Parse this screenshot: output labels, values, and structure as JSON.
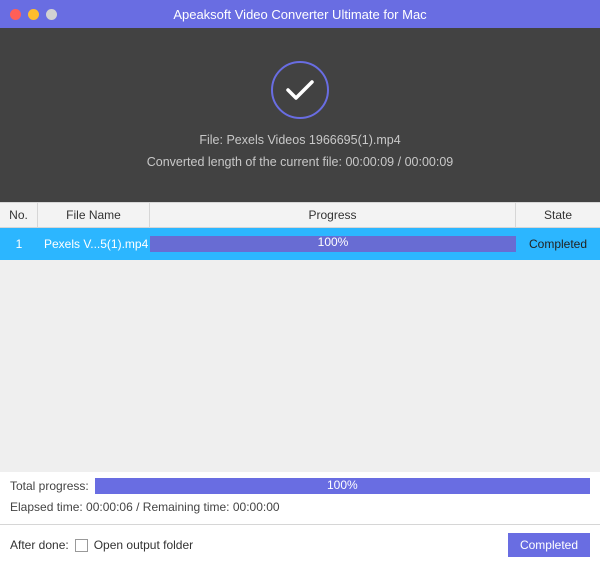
{
  "window": {
    "title": "Apeaksoft Video Converter Ultimate for Mac"
  },
  "header": {
    "file_label": "File:",
    "file_name": "Pexels Videos 1966695(1).mp4",
    "converted_prefix": "Converted length of the current file:",
    "converted_current": "00:00:09",
    "converted_sep": "/",
    "converted_total": "00:00:09"
  },
  "table": {
    "columns": {
      "no": "No.",
      "file_name": "File Name",
      "progress": "Progress",
      "state": "State"
    },
    "rows": [
      {
        "no": "1",
        "file_name": "Pexels V...5(1).mp4",
        "progress_pct": "100%",
        "state": "Completed"
      }
    ]
  },
  "summary": {
    "total_progress_label": "Total progress:",
    "total_progress_pct": "100%",
    "elapsed_label": "Elapsed time:",
    "elapsed_value": "00:00:06",
    "remaining_label": "Remaining time:",
    "remaining_value": "00:00:00",
    "sep": "/"
  },
  "footer": {
    "after_done_label": "After done:",
    "open_folder_label": "Open output folder",
    "completed_button": "Completed"
  }
}
